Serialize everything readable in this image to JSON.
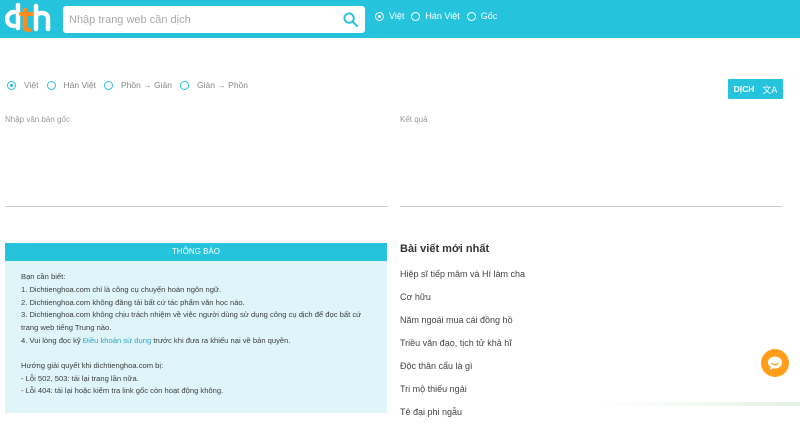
{
  "header": {
    "search_placeholder": "Nhập trang web cần dịch",
    "radios": [
      {
        "label": "Việt",
        "checked": true
      },
      {
        "label": "Hán Việt",
        "checked": false
      },
      {
        "label": "Gốc",
        "checked": false
      }
    ]
  },
  "modes": [
    {
      "label": "Việt",
      "checked": true
    },
    {
      "label": "Hán Việt",
      "checked": false
    },
    {
      "label": "Phồn → Giản",
      "checked": false
    },
    {
      "label": "Giản → Phồn",
      "checked": false
    }
  ],
  "translate_button": {
    "label": "DỊCH"
  },
  "source": {
    "placeholder": "Nhập văn bản gốc"
  },
  "result": {
    "label": "Kết quả"
  },
  "notice": {
    "title": "THÔNG BÁO",
    "intro": "Bạn cần biết:",
    "items": [
      "1. Dichtienghoa.com chỉ là công cụ chuyển hoán ngôn ngữ.",
      "2. Dichtienghoa.com không đăng tải bất cứ tác phẩm văn học nào.",
      "3. Dichtienghoa.com không chịu trách nhiệm về việc người dùng sử dụng công cụ dịch để đọc bất cứ",
      "trang web tiếng Trung nào."
    ],
    "item4_prefix": "4. Vui lòng đọc kỹ ",
    "item4_link": "Điều khoản sử dụng",
    "item4_suffix": " trước khi đưa ra khiếu nại về bản quyền.",
    "guide_title": "Hướng giải quyết khi dichtienghoa.com bị:",
    "guide_items": [
      "- Lỗi 502, 503: tải lại trang lần nữa.",
      "- Lỗi 404: tải lại hoặc kiểm tra link gốc còn hoạt động không."
    ]
  },
  "posts": {
    "title": "Bài viết mới nhất",
    "items": [
      "Hiệp sĩ tiếp mâm và Hí làm cha",
      "Cơ hữu",
      "Năm ngoái mua cái đồng hồ",
      "Triều văn đạo, tịch tử khả hĩ",
      "Độc thân cẩu là gì",
      "Tri mộ thiếu ngải",
      "Tê đại phi ngẫu"
    ]
  },
  "colors": {
    "brand": "#25c3dc",
    "notice_bg": "#dff5fa",
    "chat": "#ff9e1a"
  }
}
